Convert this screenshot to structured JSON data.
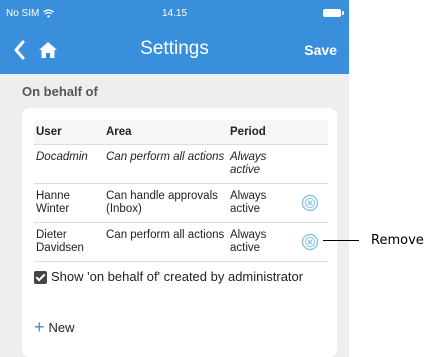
{
  "status_bar": {
    "carrier": "No SIM",
    "time": "14.15"
  },
  "nav": {
    "title": "Settings",
    "save_label": "Save"
  },
  "section": {
    "title": "On behalf of"
  },
  "table": {
    "headers": [
      "User",
      "Area",
      "Period"
    ],
    "rows": [
      {
        "user": "Docadmin",
        "area": "Can perform all actions",
        "period": "Always active",
        "removable": false
      },
      {
        "user": "Hanne Winter",
        "area": "Can handle approvals (Inbox)",
        "period": "Always active",
        "removable": true
      },
      {
        "user": "Dieter Davidsen",
        "area": "Can perform all actions",
        "period": "Always active",
        "removable": true
      }
    ]
  },
  "checkbox": {
    "label": "Show 'on behalf of' created by administrator",
    "checked": true
  },
  "new_button": {
    "label": "New"
  },
  "callout": {
    "label": "Remove"
  },
  "colors": {
    "accent": "#3a8fdc",
    "background": "#eeeeee",
    "card": "#ffffff",
    "remove_icon": "#8ec1ec"
  },
  "icons": {
    "back": "chevron-left-icon",
    "home": "home-icon",
    "wifi": "wifi-icon",
    "battery": "battery-icon",
    "remove": "remove-circle-icon",
    "plus": "plus-icon"
  }
}
